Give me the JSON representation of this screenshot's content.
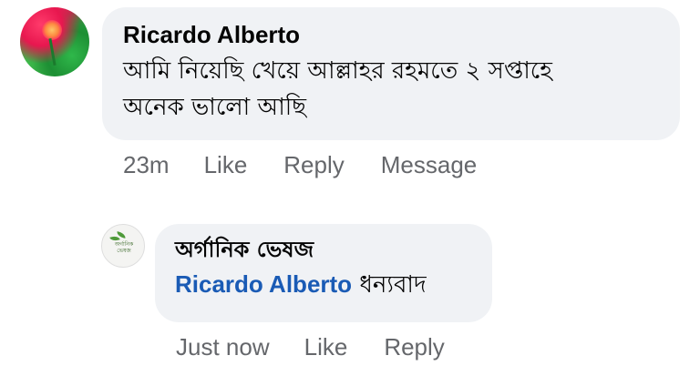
{
  "comment": {
    "author": "Ricardo Alberto",
    "text_line1": "আমি  নিয়েছি খেয়ে  আল্লাহর রহমতে ২ সপ্তাহে",
    "text_line2": "অনেক ভালো আছি",
    "time": "23m",
    "like_label": "Like",
    "reply_label": "Reply",
    "message_label": "Message"
  },
  "reply": {
    "author": "অর্গানিক ভেষজ",
    "mention": "Ricardo Alberto",
    "text": "ধন্যবাদ",
    "time": "Just now",
    "like_label": "Like",
    "reply_label": "Reply",
    "avatar_logo_text": "অর্গানিক ভেষজ"
  },
  "colors": {
    "bubble_bg": "#f0f2f5",
    "mention": "#1a5bb5",
    "meta_text": "#65676b"
  }
}
